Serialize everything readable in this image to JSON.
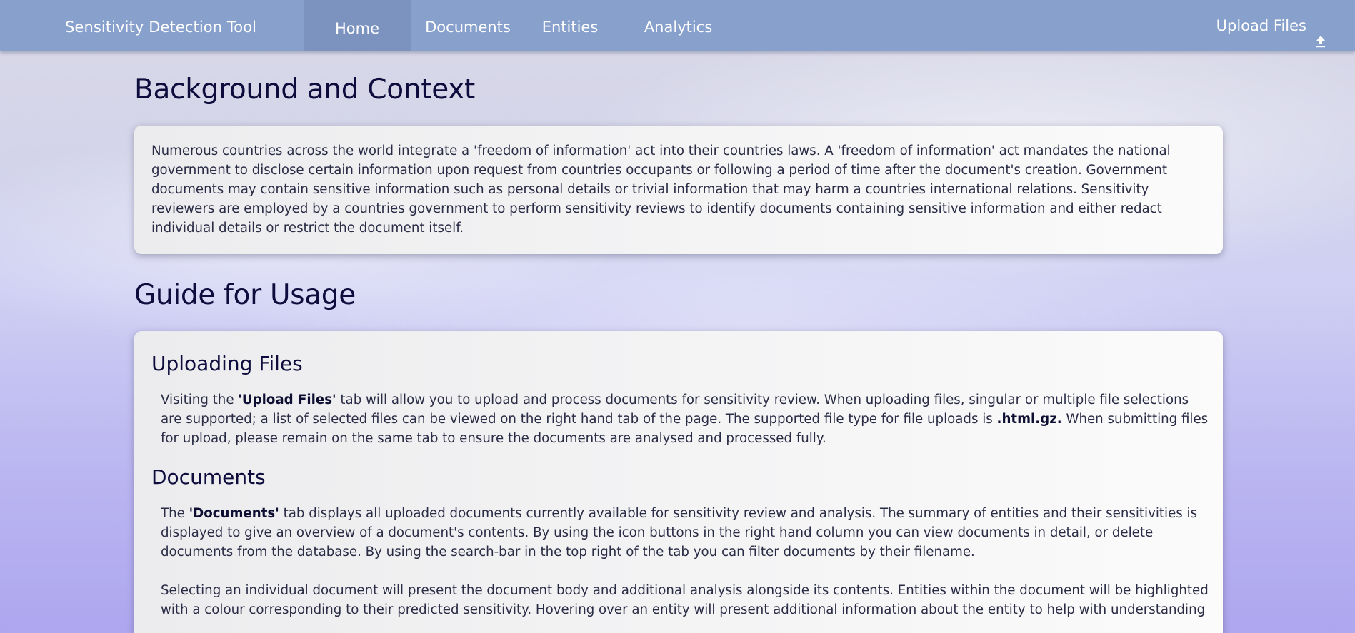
{
  "navbar": {
    "brand": "Sensitivity Detection Tool",
    "tabs": [
      {
        "label": "Home",
        "active": true
      },
      {
        "label": "Documents",
        "active": false
      },
      {
        "label": "Entities",
        "active": false
      },
      {
        "label": "Analytics",
        "active": false
      }
    ],
    "upload_label": "Upload Files",
    "upload_icon": "upload-icon"
  },
  "background": {
    "heading": "Background and Context",
    "text": "Numerous countries across the world integrate a 'freedom of information' act into their countries laws. A 'freedom of information' act mandates the national government to disclose certain information upon request from countries occupants or following a period of time after the document's creation. Government documents may contain sensitive information such as personal details or trivial information that may harm a countries international relations. Sensitivity reviewers are employed by a countries government to perform sensitivity reviews to identify documents containing sensitive information and either redact individual details or restrict the document itself."
  },
  "guide": {
    "heading": "Guide for Usage",
    "uploading": {
      "title": "Uploading Files",
      "pre": "Visiting the ",
      "tab_name": "'Upload Files'",
      "mid": " tab will allow you to upload and process documents for sensitivity review. When uploading files, singular or multiple file selections are supported; a list of selected files can be viewed on the right hand tab of the page. The supported file type for file uploads is ",
      "file_type": ".html.gz.",
      "post": " When submitting files for upload, please remain on the same tab to ensure the documents are analysed and processed fully."
    },
    "documents": {
      "title": "Documents",
      "p1_pre": "The ",
      "p1_tab_name": "'Documents'",
      "p1_post": " tab displays all uploaded documents currently available for sensitivity review and analysis. The summary of entities and their sensitivities is displayed to give an overview of a document's contents. By using the icon buttons in the right hand column you can view documents in detail, or delete documents from the database. By using the search-bar in the top right of the tab you can filter documents by their filename.",
      "p2": "Selecting an individual document will present the document body and additional analysis alongside its contents. Entities within the document will be highlighted with a colour corresponding to their predicted sensitivity. Hovering over an entity will present additional information about the entity to help with understanding"
    }
  }
}
